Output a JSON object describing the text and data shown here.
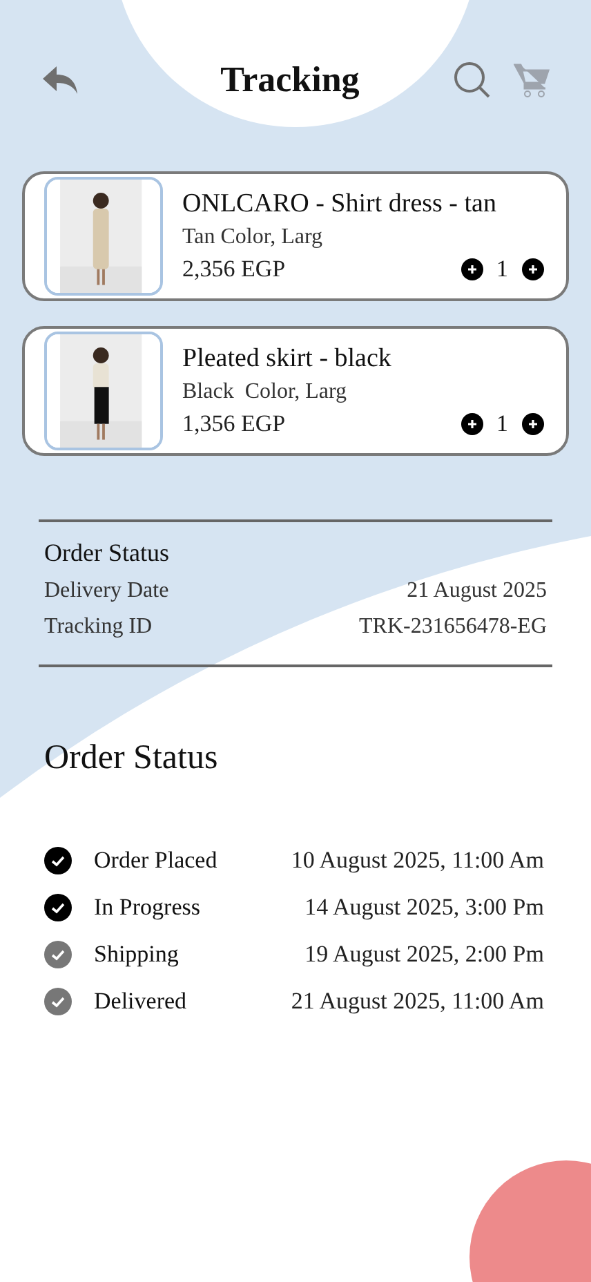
{
  "header": {
    "title": "Tracking"
  },
  "cart_items": [
    {
      "name": "ONLCARO - Shirt dress - tan",
      "variant": "Tan Color, Larg",
      "price": "2,356 EGP",
      "quantity": "1"
    },
    {
      "name": "Pleated skirt - black",
      "variant": "Black  Color, Larg",
      "price": "1,356 EGP",
      "quantity": "1"
    }
  ],
  "order_summary": {
    "title": "Order Status",
    "fields": [
      {
        "label": "Delivery Date",
        "value": "21 August 2025"
      },
      {
        "label": "Tracking ID",
        "value": "TRK-231656478-EG"
      }
    ]
  },
  "timeline": {
    "title": "Order Status",
    "steps": [
      {
        "label": "Order Placed",
        "time": "10 August 2025, 11:00 Am",
        "done": true
      },
      {
        "label": "In Progress",
        "time": "14 August 2025, 3:00 Pm",
        "done": true
      },
      {
        "label": "Shipping",
        "time": "19 August 2025, 2:00 Pm",
        "done": false
      },
      {
        "label": "Delivered",
        "time": "21 August 2025, 11:00 Am",
        "done": false
      }
    ]
  }
}
